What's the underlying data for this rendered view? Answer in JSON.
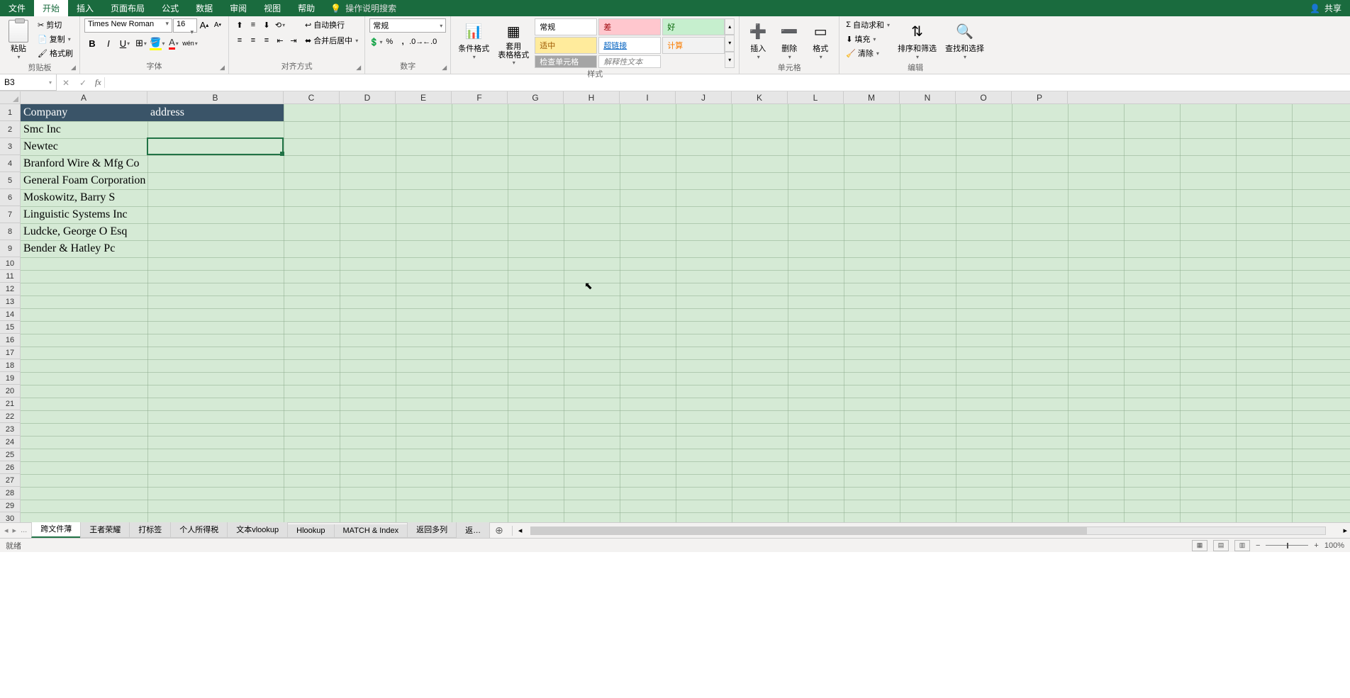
{
  "menubar": {
    "items": [
      "文件",
      "开始",
      "插入",
      "页面布局",
      "公式",
      "数据",
      "审阅",
      "视图",
      "帮助"
    ],
    "active_index": 1,
    "search_placeholder": "操作说明搜索",
    "share": "共享"
  },
  "ribbon": {
    "clipboard": {
      "paste": "粘贴",
      "cut": "剪切",
      "copy": "复制",
      "format_painter": "格式刷",
      "label": "剪贴板"
    },
    "font": {
      "font_name": "Times New Roman",
      "font_size": "16",
      "increase": "A",
      "decrease": "A",
      "bold": "B",
      "italic": "I",
      "underline": "U",
      "label": "字体"
    },
    "alignment": {
      "wrap": "自动换行",
      "merge": "合并后居中",
      "label": "对齐方式"
    },
    "number": {
      "format": "常规",
      "percent": "%",
      "comma": ",",
      "label": "数字"
    },
    "styles": {
      "cond_format": "条件格式",
      "table_format": "套用\n表格格式",
      "gallery": [
        "常规",
        "差",
        "好",
        "适中",
        "超链接",
        "计算",
        "检查单元格",
        "解释性文本"
      ],
      "label": "样式"
    },
    "cells": {
      "insert": "插入",
      "delete": "删除",
      "format": "格式",
      "label": "单元格"
    },
    "editing": {
      "autosum": "自动求和",
      "fill": "填充",
      "clear": "清除",
      "sort": "排序和筛选",
      "find": "查找和选择",
      "label": "编辑"
    }
  },
  "formula_bar": {
    "name_box": "B3",
    "formula": ""
  },
  "grid": {
    "columns": [
      "A",
      "B",
      "C",
      "D",
      "E",
      "F",
      "G",
      "H",
      "I",
      "J",
      "K",
      "L",
      "M",
      "N",
      "O",
      "P"
    ],
    "row_count": 30,
    "header_row": {
      "A": "Company",
      "B": "address"
    },
    "data_rows": [
      "Smc Inc",
      "Newtec",
      "Branford Wire & Mfg Co",
      "General Foam Corporation",
      "Moskowitz, Barry S",
      "Linguistic Systems Inc",
      "Ludcke, George O Esq",
      "Bender & Hatley Pc"
    ],
    "active_cell": "B3"
  },
  "sheets": {
    "nav_ellipsis": "...",
    "tabs": [
      "跨文件薄",
      "王者荣耀",
      "打标签",
      "个人所得税",
      "文本vlookup",
      "Hlookup",
      "MATCH & Index",
      "返回多列"
    ],
    "overflow_tab": "返…",
    "active_index": 0
  },
  "status": {
    "ready": "就绪",
    "zoom": "100%"
  }
}
